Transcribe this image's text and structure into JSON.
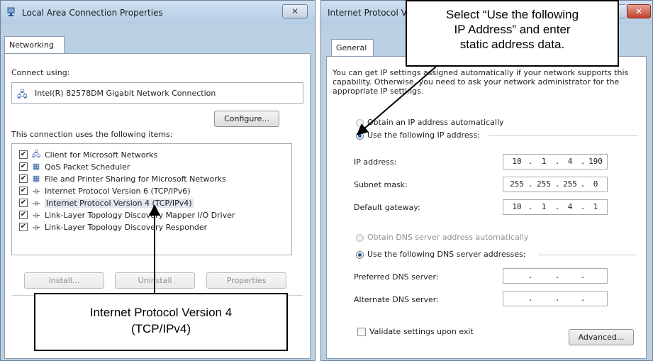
{
  "left_dialog": {
    "title": "Local Area Connection Properties",
    "close_label": "✕",
    "tab": "Networking",
    "connect_using_label": "Connect using:",
    "adapter_name": "Intel(R) 82578DM Gigabit Network Connection",
    "configure_button": "Configure...",
    "items_label": "This connection uses the following items:",
    "items": [
      {
        "label": "Client for Microsoft Networks",
        "checked": true,
        "icon": "network-client-icon"
      },
      {
        "label": "QoS Packet Scheduler",
        "checked": true,
        "icon": "service-icon"
      },
      {
        "label": "File and Printer Sharing for Microsoft Networks",
        "checked": true,
        "icon": "service-icon"
      },
      {
        "label": "Internet Protocol Version 6 (TCP/IPv6)",
        "checked": true,
        "icon": "protocol-icon"
      },
      {
        "label": "Internet Protocol Version 4 (TCP/IPv4)",
        "checked": true,
        "icon": "protocol-icon"
      },
      {
        "label": "Link-Layer Topology Discovery Mapper I/O Driver",
        "checked": true,
        "icon": "protocol-icon"
      },
      {
        "label": "Link-Layer Topology Discovery Responder",
        "checked": true,
        "icon": "protocol-icon"
      }
    ],
    "install_button": "Install...",
    "uninstall_button": "Uninstall",
    "properties_button": "Properties"
  },
  "right_dialog": {
    "title": "Internet Protocol V",
    "close_label": "✕",
    "tab": "General",
    "description": "You can get IP settings assigned automatically if your network supports this capability. Otherwise, you need to ask your network administrator for the appropriate IP settings.",
    "obtain_ip_auto": "Obtain an IP address automatically",
    "use_following_ip": "Use the following IP address:",
    "ip_address_label": "IP address:",
    "ip_address": [
      "10",
      "1",
      "4",
      "190"
    ],
    "subnet_mask_label": "Subnet mask:",
    "subnet_mask": [
      "255",
      "255",
      "255",
      "0"
    ],
    "default_gateway_label": "Default gateway:",
    "default_gateway": [
      "10",
      "1",
      "4",
      "1"
    ],
    "obtain_dns_auto": "Obtain DNS server address automatically",
    "use_following_dns": "Use the following DNS server addresses:",
    "preferred_dns_label": "Preferred DNS server:",
    "alternate_dns_label": "Alternate DNS server:",
    "validate_label": "Validate settings upon exit",
    "advanced_button": "Advanced..."
  },
  "callouts": {
    "top_line1": "Select “Use the following",
    "top_line2": "IP Address” and enter",
    "top_line3": "static address data.",
    "bottom_line1": "Internet Protocol Version 4",
    "bottom_line2": "(TCP/IPv4)"
  }
}
